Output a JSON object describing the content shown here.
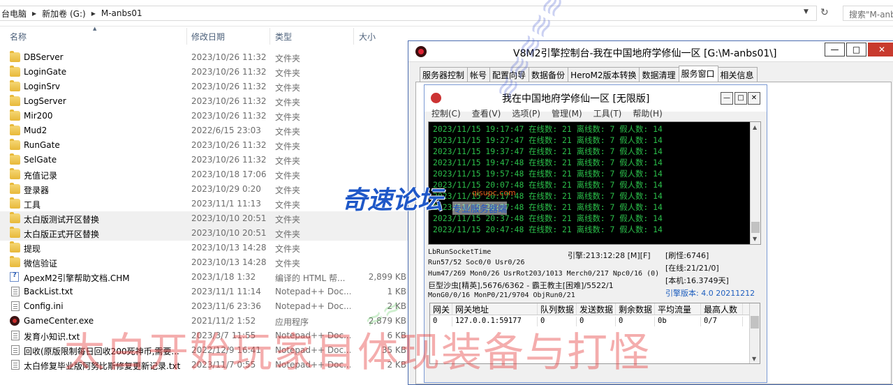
{
  "address": {
    "crumbs": [
      "台电脑",
      "新加卷 (G:)",
      "M-anbs01"
    ],
    "search_placeholder": "搜索\"M-anbs"
  },
  "columns": {
    "name": "名称",
    "date": "修改日期",
    "type": "类型",
    "size": "大小"
  },
  "files": [
    {
      "name": "DBServer",
      "date": "2023/10/26 11:32",
      "type": "文件夹",
      "size": "",
      "icon": "folder-icon"
    },
    {
      "name": "LoginGate",
      "date": "2023/10/26 11:32",
      "type": "文件夹",
      "size": "",
      "icon": "folder-icon"
    },
    {
      "name": "LoginSrv",
      "date": "2023/10/26 11:32",
      "type": "文件夹",
      "size": "",
      "icon": "folder-icon"
    },
    {
      "name": "LogServer",
      "date": "2023/10/26 11:32",
      "type": "文件夹",
      "size": "",
      "icon": "folder-icon"
    },
    {
      "name": "Mir200",
      "date": "2023/10/26 11:32",
      "type": "文件夹",
      "size": "",
      "icon": "folder-icon"
    },
    {
      "name": "Mud2",
      "date": "2022/6/15 23:03",
      "type": "文件夹",
      "size": "",
      "icon": "folder-icon"
    },
    {
      "name": "RunGate",
      "date": "2023/10/26 11:32",
      "type": "文件夹",
      "size": "",
      "icon": "folder-icon"
    },
    {
      "name": "SelGate",
      "date": "2023/10/26 11:32",
      "type": "文件夹",
      "size": "",
      "icon": "folder-icon"
    },
    {
      "name": "充值记录",
      "date": "2023/10/18 17:06",
      "type": "文件夹",
      "size": "",
      "icon": "folder-icon"
    },
    {
      "name": "登录器",
      "date": "2023/10/29 0:20",
      "type": "文件夹",
      "size": "",
      "icon": "folder-icon"
    },
    {
      "name": "工具",
      "date": "2023/11/1 11:13",
      "type": "文件夹",
      "size": "",
      "icon": "folder-icon"
    },
    {
      "name": "太白版测试开区替换",
      "date": "2023/10/10 20:51",
      "type": "文件夹",
      "size": "",
      "icon": "folder-icon",
      "selected": true
    },
    {
      "name": "太白版正式开区替换",
      "date": "2023/10/10 20:51",
      "type": "文件夹",
      "size": "",
      "icon": "folder-icon",
      "selected": true
    },
    {
      "name": "提现",
      "date": "2023/10/13 14:28",
      "type": "文件夹",
      "size": "",
      "icon": "folder-icon"
    },
    {
      "name": "微信验证",
      "date": "2023/10/13 14:28",
      "type": "文件夹",
      "size": "",
      "icon": "folder-icon"
    },
    {
      "name": "ApexM2引擎帮助文档.CHM",
      "date": "2023/1/18 1:32",
      "type": "编译的 HTML 帮...",
      "size": "2,899 KB",
      "icon": "chm-icon"
    },
    {
      "name": "BackList.txt",
      "date": "2023/11/1 11:14",
      "type": "Notepad++ Doc...",
      "size": "1 KB",
      "icon": "text-file-icon"
    },
    {
      "name": "Config.ini",
      "date": "2023/11/6 23:36",
      "type": "Notepad++ Doc...",
      "size": "2 KB",
      "icon": "text-file-icon"
    },
    {
      "name": "GameCenter.exe",
      "date": "2021/11/2 1:52",
      "type": "应用程序",
      "size": "2,879 KB",
      "icon": "app-icon"
    },
    {
      "name": "发育小知识.txt",
      "date": "2023/3/7 11:55",
      "type": "Notepad++ Doc...",
      "size": "6 KB",
      "icon": "text-file-icon"
    },
    {
      "name": "回收(原版限制每日回收200死神币,需要...",
      "date": "2022/12/9 16:41",
      "type": "Notepad++ Doc...",
      "size": "35 KB",
      "icon": "text-file-icon"
    },
    {
      "name": "太白修复毕业版阿努比斯修复更新记录.txt",
      "date": "2023/11/7 0:55",
      "type": "Notepad++ Doc...",
      "size": "2 KB",
      "icon": "text-file-icon"
    }
  ],
  "engine": {
    "title": "V8M2引擎控制台-我在中国地府学修仙一区 [G:\\M-anbs01\\]",
    "min_label": "—",
    "max_label": "□",
    "close_label": "✕",
    "tabs": [
      "服务器控制",
      "帐号",
      "配置向导",
      "数据备份",
      "HeroM2版本转换",
      "数据清理",
      "服务窗口",
      "相关信息"
    ],
    "active_tab": 6
  },
  "inner": {
    "title": "我在中国地府学修仙一区 [无限版]",
    "menu": [
      "控制(C)",
      "查看(V)",
      "选项(P)",
      "管理(M)",
      "工具(T)",
      "帮助(H)"
    ],
    "log_lines": [
      "2023/11/15 19:17:47 在线数: 21 离线数: 7 假人数: 14",
      "2023/11/15 19:27:47 在线数: 21 离线数: 7 假人数: 14",
      "2023/11/15 19:37:47 在线数: 21 离线数: 7 假人数: 14",
      "2023/11/15 19:47:48 在线数: 21 离线数: 7 假人数: 14",
      "2023/11/15 19:57:48 在线数: 21 离线数: 7 假人数: 14",
      "2023/11/15 20:07:48 在线数: 21 离线数: 7 假人数: 14",
      "2023/11/15 20:17:48 在线数: 21 离线数: 7 假人数: 14",
      "2023/11/15 20:27:48 在线数: 21 离线数: 7 假人数: 14",
      "2023/11/15 20:37:48 在线数: 21 离线数: 7 假人数: 14",
      "2023/11/15 20:47:48 在线数: 21 离线数: 7 假人数: 14"
    ],
    "stats": {
      "socket": "LbRunSocketTime",
      "engine_time": "引擎:213:12:28 [M][F]",
      "refresh": "[刷怪:6746]",
      "run": "Run57/52 Soc0/0 Usr0/26",
      "online": "[在线:21/21/0]",
      "hum": "Hum47/269 Mon0/26 UsrRot203/1013 Merch0/217 Npc0/16 (0)",
      "uptime": "[本机:16.3749天]",
      "boss": "巨型沙虫[精英],5676/6362 - 霸王教主[困难]/5522/1",
      "mon": "MonG0/0/16 MonP0/21/9704 ObjRun0/21",
      "version": "引擎版本: 4.0 20211212"
    },
    "table_headers": [
      "网关",
      "网关地址",
      "队列数据",
      "发送数据",
      "剩余数据",
      "平均流量",
      "最高人数"
    ],
    "table_rows": [
      [
        "0",
        "127.0.0.1:59177",
        "0",
        "0",
        "0",
        "0b",
        "0/7"
      ]
    ]
  },
  "watermarks": {
    "big": "太白开始玩家目体现装备与打怪",
    "logo": "奇速论坛",
    "sub": "专业服务器端",
    "url": "qisupc.com"
  }
}
